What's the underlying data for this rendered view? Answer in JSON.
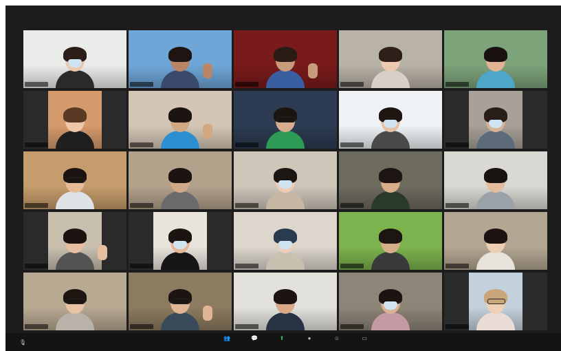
{
  "meeting": {
    "tiles": [
      {
        "name": "",
        "bg": "#e9ece9",
        "skin": "#e9c9ad",
        "hair": "#2b1d17",
        "shirt": "#2a2a2a",
        "mask": true,
        "glasses": false,
        "active": true
      },
      {
        "name": "",
        "bg": "#6ea6d8",
        "skin": "#b98566",
        "hair": "#1e1512",
        "shirt": "#3a4a6a",
        "mask": false,
        "glasses": false,
        "active": false
      },
      {
        "name": "",
        "bg": "#7a1b1b",
        "skin": "#c99b7d",
        "hair": "#2a1c14",
        "shirt": "#3a5fa0",
        "mask": false,
        "glasses": false,
        "active": false
      },
      {
        "name": "",
        "bg": "#b9b2a6",
        "skin": "#ecc8ae",
        "hair": "#2e2018",
        "shirt": "#d8d0c8",
        "mask": false,
        "glasses": false,
        "active": false
      },
      {
        "name": "",
        "bg": "#7da37a",
        "skin": "#e0b393",
        "hair": "#1a1210",
        "shirt": "#4ea6c8",
        "mask": false,
        "glasses": false,
        "active": false
      },
      {
        "name": "",
        "bg": "#d59a6c",
        "skin": "#efc6a8",
        "hair": "#5a3a24",
        "shirt": "#1f1f1f",
        "mask": false,
        "glasses": false,
        "active": false
      },
      {
        "name": "",
        "bg": "#d3c6b4",
        "skin": "#d2a883",
        "hair": "#1b1410",
        "shirt": "#2d8fd0",
        "mask": false,
        "glasses": false,
        "active": false
      },
      {
        "name": "",
        "bg": "#2d3c52",
        "skin": "#d6ad8e",
        "hair": "#1b1512",
        "shirt": "#2d9a55",
        "mask": false,
        "glasses": true,
        "active": false
      },
      {
        "name": "",
        "bg": "#eef2f4",
        "skin": "#e7c2a6",
        "hair": "#1f1612",
        "shirt": "#4a4a4a",
        "mask": true,
        "glasses": false,
        "active": false
      },
      {
        "name": "",
        "bg": "#a7a198",
        "skin": "#d7b296",
        "hair": "#2a1e18",
        "shirt": "#5d6a7a",
        "mask": true,
        "glasses": false,
        "active": false
      },
      {
        "name": "",
        "bg": "#c59c6b",
        "skin": "#e5bb98",
        "hair": "#1b1410",
        "shirt": "#dfe3e8",
        "mask": false,
        "glasses": true,
        "active": false
      },
      {
        "name": "",
        "bg": "#b3a18c",
        "skin": "#d1a888",
        "hair": "#1c1411",
        "shirt": "#6b6b6b",
        "mask": false,
        "glasses": false,
        "active": false
      },
      {
        "name": "",
        "bg": "#cfc6ba",
        "skin": "#efcdb5",
        "hair": "#1c1613",
        "shirt": "#c7b8a4",
        "mask": true,
        "glasses": false,
        "active": false
      },
      {
        "name": "",
        "bg": "#6d6a5e",
        "skin": "#d8ae8d",
        "hair": "#1c1512",
        "shirt": "#2a3a2a",
        "mask": false,
        "glasses": false,
        "active": false
      },
      {
        "name": "",
        "bg": "#dad8d2",
        "skin": "#e4bd9f",
        "hair": "#1a1411",
        "shirt": "#9aa1a8",
        "mask": false,
        "glasses": false,
        "active": false
      },
      {
        "name": "",
        "bg": "#c8bfae",
        "skin": "#e5bf9f",
        "hair": "#1b1411",
        "shirt": "#545454",
        "mask": false,
        "glasses": false,
        "active": false
      },
      {
        "name": "",
        "bg": "#e8e4dc",
        "skin": "#e3b898",
        "hair": "#1b1411",
        "shirt": "#161616",
        "mask": true,
        "glasses": false,
        "active": false
      },
      {
        "name": "",
        "bg": "#dcd6cc",
        "skin": "#ead0bc",
        "hair": "#2b3b4f",
        "shirt": "#c9c0b2",
        "mask": true,
        "glasses": false,
        "active": false
      },
      {
        "name": "",
        "bg": "#7db34f",
        "skin": "#d6ad8b",
        "hair": "#1c1612",
        "shirt": "#3a3a3a",
        "mask": false,
        "glasses": false,
        "active": false
      },
      {
        "name": "",
        "bg": "#b3a692",
        "skin": "#edcdb4",
        "hair": "#1b1411",
        "shirt": "#e8e3da",
        "mask": false,
        "glasses": false,
        "active": false
      },
      {
        "name": "",
        "bg": "#b8a992",
        "skin": "#e8c2a3",
        "hair": "#1d1510",
        "shirt": "#b8b2a8",
        "mask": false,
        "glasses": true,
        "active": false
      },
      {
        "name": "",
        "bg": "#8c7b5f",
        "skin": "#e0b594",
        "hair": "#1b1411",
        "shirt": "#3a4a5a",
        "mask": false,
        "glasses": true,
        "active": false
      },
      {
        "name": "",
        "bg": "#e3e1dc",
        "skin": "#d9a987",
        "hair": "#1b1411",
        "shirt": "#273244",
        "mask": false,
        "glasses": false,
        "active": false
      },
      {
        "name": "",
        "bg": "#8e8478",
        "skin": "#d9b194",
        "hair": "#1b1411",
        "shirt": "#c69aa2",
        "mask": true,
        "glasses": false,
        "active": false
      },
      {
        "name": "",
        "bg": "#c3d1dc",
        "skin": "#efcfb6",
        "hair": "#c9a57a",
        "shirt": "#e9dcd6",
        "mask": false,
        "glasses": true,
        "active": false
      }
    ]
  },
  "toolbar": {
    "left_label": "",
    "items": [
      {
        "icon": "participants-icon",
        "glyph": "👥",
        "label": "",
        "green": false
      },
      {
        "icon": "chat-icon",
        "glyph": "💬",
        "label": "",
        "green": false
      },
      {
        "icon": "share-screen-icon",
        "glyph": "⬆",
        "label": "",
        "green": true
      },
      {
        "icon": "record-icon",
        "glyph": "●",
        "label": "",
        "green": false
      },
      {
        "icon": "reactions-icon",
        "glyph": "☺",
        "label": "",
        "green": false
      },
      {
        "icon": "more-icon",
        "glyph": "▭",
        "label": "",
        "green": false
      }
    ]
  }
}
